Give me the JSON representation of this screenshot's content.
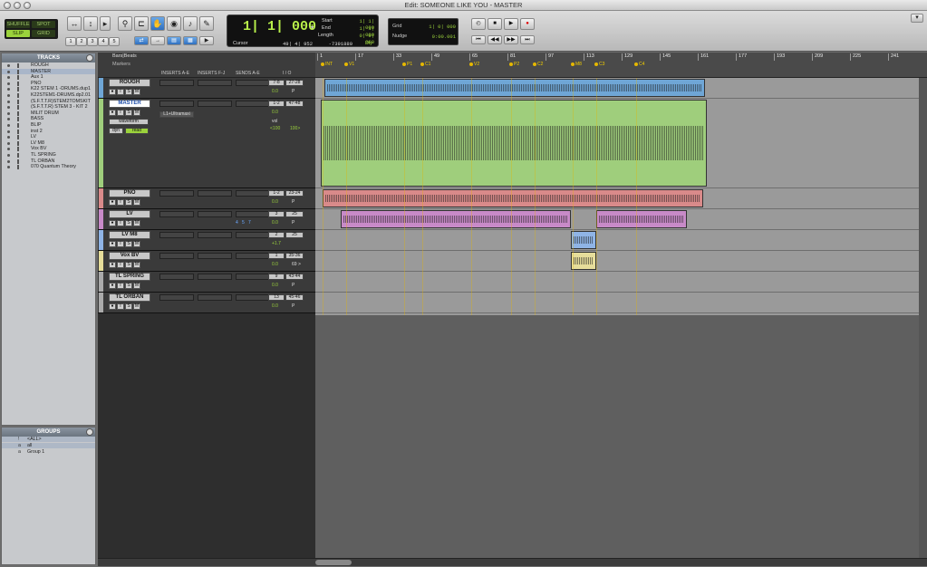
{
  "window": {
    "title": "Edit: SOMEONE LIKE YOU - MASTER"
  },
  "edit_modes": {
    "shuffle": "SHUFFLE",
    "spot": "SPOT",
    "slip": "SLIP",
    "grid": "GRID"
  },
  "zoom_presets": [
    "1",
    "2",
    "3",
    "4",
    "5"
  ],
  "counter": {
    "main": "1| 1| 000",
    "start_label": "Start",
    "start_value": "1| 1| 000",
    "end_label": "End",
    "end_value": "1| 1| 000",
    "length_label": "Length",
    "length_value": "0| 0| 000",
    "cursor_label": "Cursor",
    "cursor_value": "49| 4| 952",
    "sample_value": "-7391880",
    "dly_label": "Dly"
  },
  "grid_nudge": {
    "grid_label": "Grid",
    "grid_value": "1| 0| 000",
    "nudge_label": "Nudge",
    "nudge_value": "0:00.001"
  },
  "tracks_panel": {
    "title": "TRACKS",
    "items": [
      {
        "name": "ROUGH"
      },
      {
        "name": "MASTER",
        "selected": true
      },
      {
        "name": "Aux 1"
      },
      {
        "name": "PNO"
      },
      {
        "name": "K22 STEM 1 -DRUMS.dup1"
      },
      {
        "name": "K22STEM1-DRUMS.dp2.01"
      },
      {
        "name": "(S.F.T.T.R)STEM2TOMSKIT"
      },
      {
        "name": "(S.F.T.T.R) STEM 3 - KIT 2"
      },
      {
        "name": "MILIT DRUM"
      },
      {
        "name": "BASS"
      },
      {
        "name": "BLIP"
      },
      {
        "name": "inst 2"
      },
      {
        "name": "LV"
      },
      {
        "name": "LV M8"
      },
      {
        "name": "Vox BV"
      },
      {
        "name": "TL SPRING"
      },
      {
        "name": "TL ORBAN"
      },
      {
        "name": "070 Quantum Theory"
      }
    ]
  },
  "groups_panel": {
    "title": "GROUPS",
    "items": [
      {
        "key": "!",
        "name": "<ALL>"
      },
      {
        "key": "a",
        "name": "all"
      },
      {
        "key": "a",
        "name": "Group 1"
      }
    ]
  },
  "ruler": {
    "bars_beats": "Bars|Beats",
    "markers": "Markers",
    "bars": [
      "1",
      "17",
      "33",
      "49",
      "65",
      "81",
      "97",
      "113",
      "129",
      "145",
      "161",
      "177",
      "193",
      "209",
      "225",
      "241"
    ],
    "marker_names": [
      "INT",
      "V1",
      "P1",
      "C1",
      "V2",
      "P2",
      "C2",
      "M8",
      "C3",
      "C4"
    ]
  },
  "columns": {
    "inserts_ae": "INSERTS A-E",
    "inserts_fj": "INSERTS F-J",
    "sends_ae": "SENDS A-E",
    "io": "I / O"
  },
  "tracks": [
    {
      "name": "ROUGH",
      "in": "7-8",
      "out": "27-28",
      "vol": "0.0",
      "pan": "P",
      "color": "#6fa6d6"
    },
    {
      "name": "MASTER",
      "in": "1-2",
      "out": "47-48",
      "plugin": "L1+Ultramaxi",
      "view": "waveform",
      "auto": "read",
      "dyn": "dyn",
      "vol_label": "vol",
      "vol": "0.0",
      "pan_l": "<100",
      "pan_r": "100>",
      "color": "#9fce7c"
    },
    {
      "name": "PNO",
      "in": "1-2",
      "out": "23-24",
      "vol": "0.0",
      "pan": "P",
      "color": "#d98a8a"
    },
    {
      "name": "LV",
      "in": "3",
      "out": "25",
      "vol": "0.0",
      "pan": "P",
      "sends": [
        "4",
        "5",
        "7"
      ],
      "color": "#c88ac8"
    },
    {
      "name": "LV M8",
      "in": "2",
      "out": "25",
      "vol": "+1.7",
      "pan": "",
      "color": "#8fb4e6"
    },
    {
      "name": "Vox BV",
      "in": "1",
      "out": "35-36",
      "vol": "0.0",
      "pan": "69 >",
      "color": "#e6dd9a"
    },
    {
      "name": "TL SPRING",
      "in": "9",
      "out": "43-44",
      "vol": "0.0",
      "pan": "P",
      "color": "#aaa"
    },
    {
      "name": "TL ORBAN",
      "in": "13",
      "out": "45-46",
      "vol": "0.0",
      "pan": "P",
      "color": "#aaa"
    }
  ]
}
